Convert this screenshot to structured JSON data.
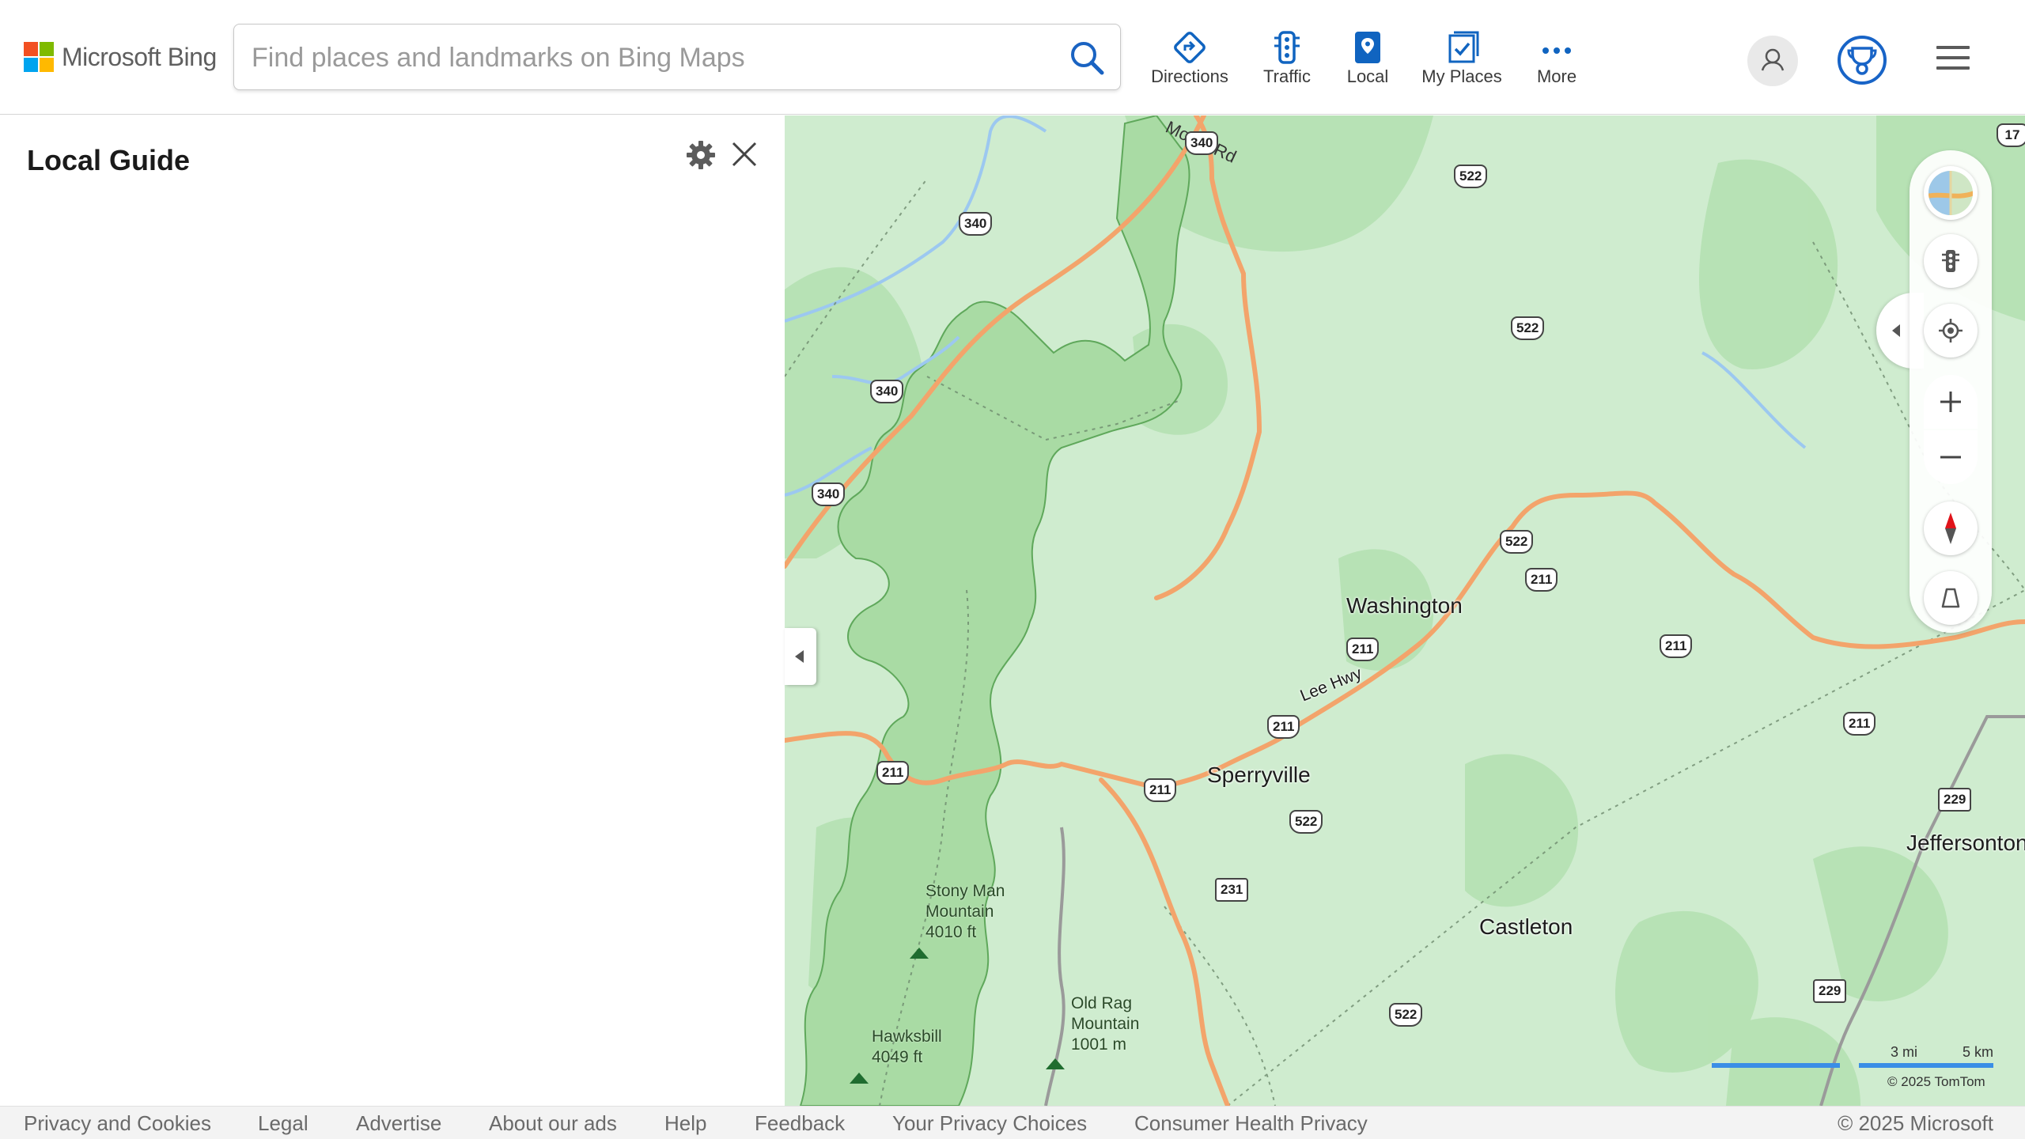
{
  "header": {
    "brand": "Microsoft Bing",
    "search_placeholder": "Find places and landmarks on Bing Maps",
    "nav": [
      {
        "label": "Directions",
        "icon": "directions-icon"
      },
      {
        "label": "Traffic",
        "icon": "traffic-icon"
      },
      {
        "label": "Local",
        "icon": "local-icon"
      },
      {
        "label": "My Places",
        "icon": "my-places-icon"
      },
      {
        "label": "More",
        "icon": "more-icon"
      }
    ]
  },
  "panel": {
    "title": "Local Guide"
  },
  "map": {
    "towns": [
      "Washington",
      "Sperryville",
      "Castleton",
      "Jeffersonton"
    ],
    "road_label": "Lee Hwy",
    "road_name_top": "Mount Rd",
    "peaks": {
      "stony_man": "Stony Man\nMountain\n4010 ft",
      "old_rag": "Old Rag\nMountain\n1001 m",
      "hawksbill": "Hawksbill\n4049 ft"
    },
    "shields": {
      "s340a": "340",
      "s340b": "340",
      "s340c": "340",
      "s340d": "340",
      "s522a": "522",
      "s522b": "522",
      "s522c": "522",
      "s522d": "522",
      "s522e": "522",
      "s211a": "211",
      "s211b": "211",
      "s211c": "211",
      "s211d": "211",
      "s211e": "211",
      "s211f": "211",
      "s211g": "211",
      "s231": "231",
      "s229a": "229",
      "s229b": "229",
      "s17": "17"
    },
    "scale": {
      "miles": "3 mi",
      "km": "5 km"
    },
    "attribution": "© 2025 TomTom"
  },
  "footer": {
    "links": [
      "Privacy and Cookies",
      "Legal",
      "Advertise",
      "About our ads",
      "Help",
      "Feedback",
      "Your Privacy Choices",
      "Consumer Health Privacy"
    ],
    "copyright": "© 2025 Microsoft"
  },
  "colors": {
    "accent": "#0f6cbd",
    "map_base": "#cfeccf",
    "park": "#a9dba4",
    "forest": "#b5e3b2",
    "highway": "#f3a46b",
    "water": "#9cc8f0"
  }
}
